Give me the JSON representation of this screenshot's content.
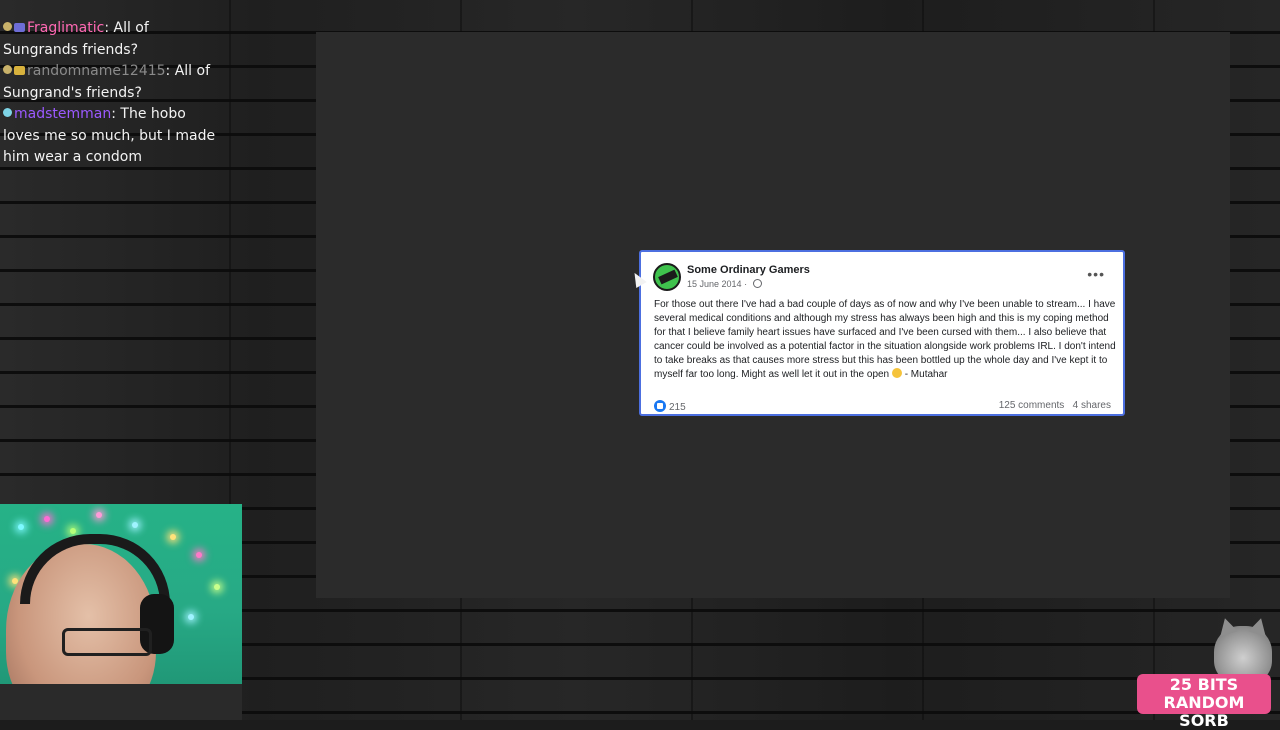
{
  "chat": {
    "messages": [
      {
        "user": "Fraglimatic",
        "text": "All of Sungrands friends?",
        "user_color": "#ff69b4"
      },
      {
        "user": "randomname12415",
        "text": "All of Sungrand's friends?",
        "user_color": "#8a8a8a"
      },
      {
        "user": "madstemman",
        "text": "The hobo loves me so much, but I made him wear a condom",
        "user_color": "#9b59ff"
      }
    ],
    "separator": ":"
  },
  "post": {
    "author": "Some Ordinary Gamers",
    "date": "15 June 2014",
    "more_icon": "more-options-icon",
    "body": "For those out there I've had a bad couple of days as of now and why I've been unable to stream... I have several medical conditions and although my stress has always been high and this is my coping method for that I believe family heart issues have surfaced and I've been cursed with them... I also believe that cancer could be involved as a potential factor in the situation alongside work problems IRL. I don't intend to take breaks as that causes more stress but this has been bottled up the whole day and I've kept it to myself far too long. Might as well let it out in the open",
    "signoff": "- Mutahar",
    "likes": "215",
    "comments": "125 comments",
    "shares": "4 shares"
  },
  "alert": {
    "line1": "25 BITS",
    "line2": "RANDOM SORB"
  },
  "colors": {
    "post_border": "#4c6fe0",
    "alert_bg": "#e9508c",
    "webcam_bg": "#26b287"
  }
}
